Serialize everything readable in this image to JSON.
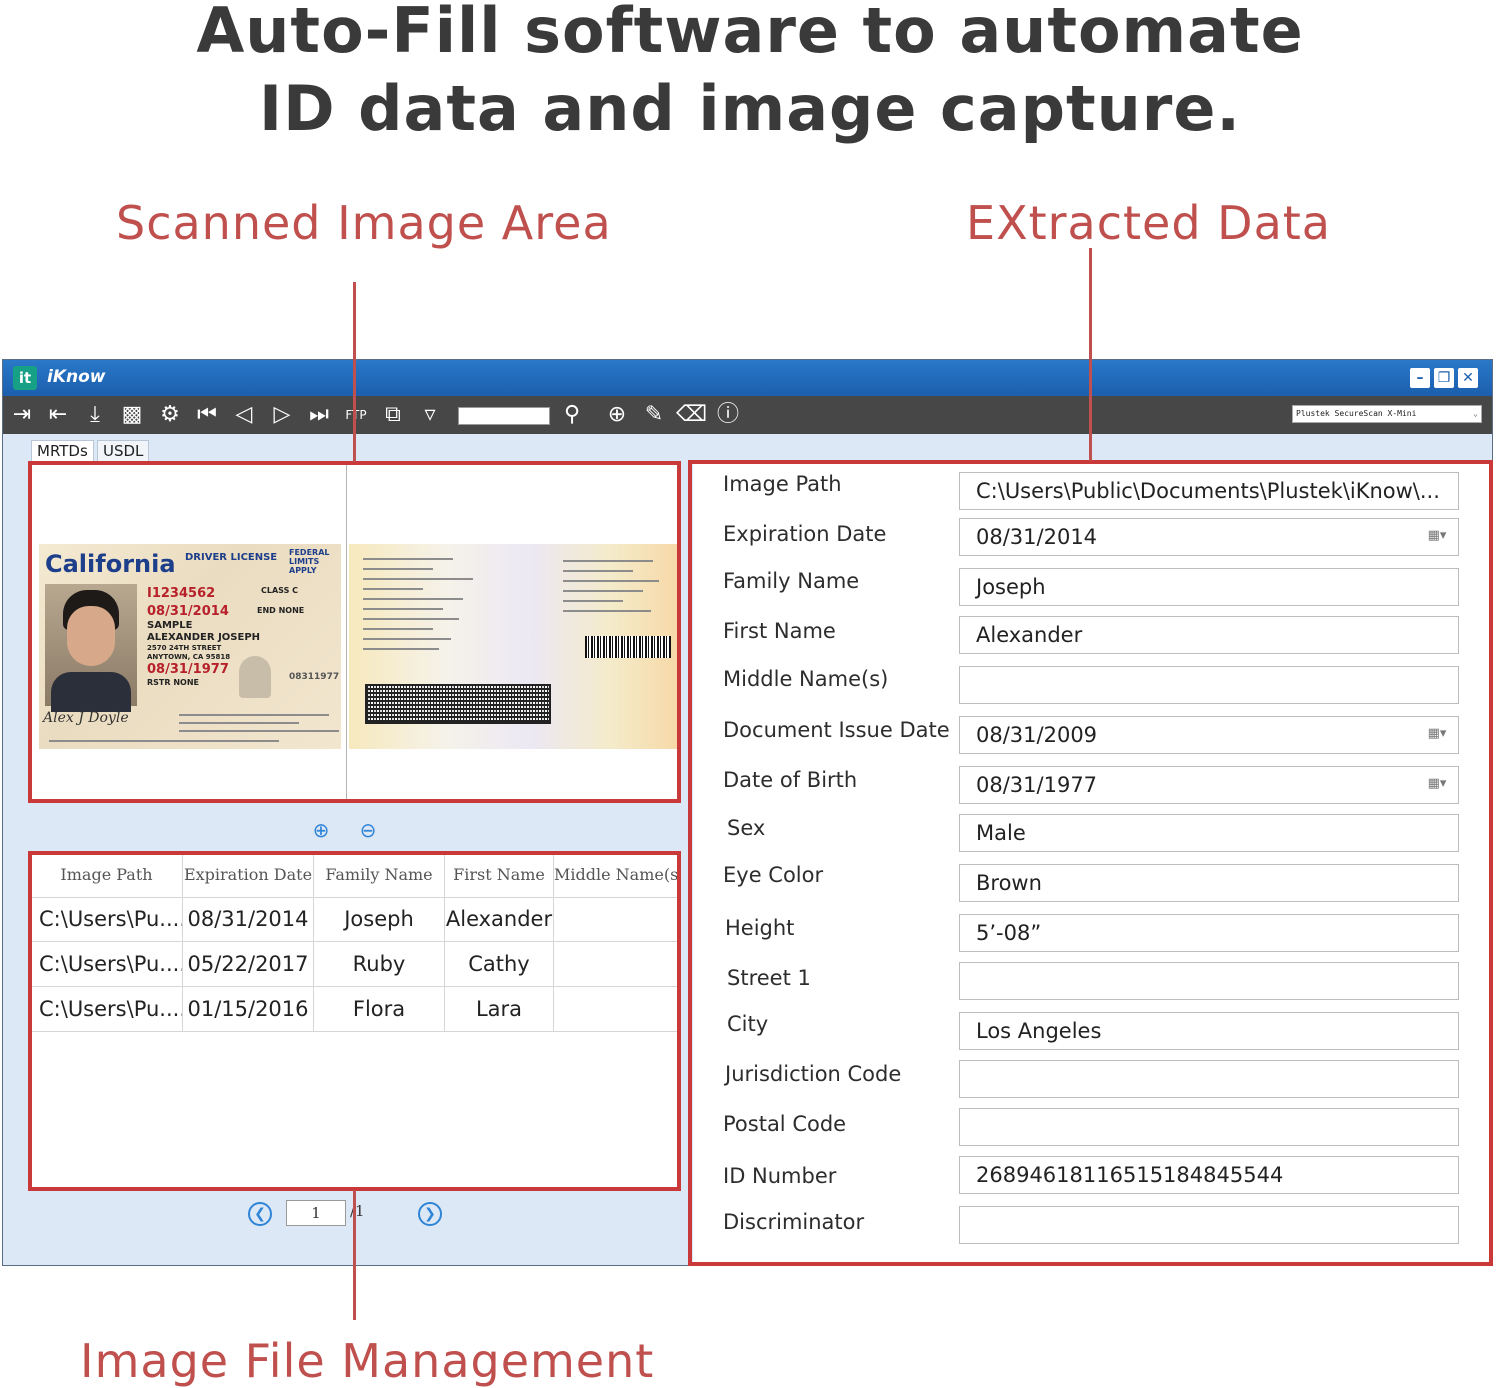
{
  "headline": {
    "line1": "Auto-Fill software to automate",
    "line2": "ID data and image capture."
  },
  "callouts": {
    "scanned_image_area": "Scanned Image Area",
    "extracted_data": "EXtracted Data",
    "image_file_management": "Image File Management"
  },
  "colors": {
    "accent_red": "#c9393a",
    "titlebar_blue": "#1b5fae",
    "toolbar_dark": "#474747",
    "panel_bg": "#dde8f6"
  },
  "app": {
    "logo_glyph": "it",
    "name": "iKnow",
    "window_controls": [
      "minimize",
      "restore",
      "close"
    ]
  },
  "toolbar": {
    "icons": [
      "export-icon",
      "import-icon",
      "download-icon",
      "delete-icon",
      "settings-icon",
      "first-page-icon",
      "previous-icon",
      "next-icon",
      "last-page-icon",
      "ftp-icon",
      "copy-icon",
      "filter-icon",
      "search-icon",
      "crosshair-icon",
      "edit-icon",
      "eraser-icon",
      "info-icon"
    ],
    "search_value": "",
    "scanner_select": "Plustek SecureScan X-Mini"
  },
  "tabs": [
    "MRTDs",
    "USDL"
  ],
  "id_card": {
    "state": "California",
    "type": "DRIVER LICENSE",
    "federal": "FEDERAL LIMITS APPLY",
    "dl_number": "I1234562",
    "exp": "08/31/2014",
    "last_name": "SAMPLE",
    "first_name": "ALEXANDER JOSEPH",
    "address1": "2570 24TH STREET",
    "address2": "ANYTOWN, CA 95818",
    "dob": "08/31/1977",
    "class": "CLASS C",
    "end": "END NONE",
    "rstr": "RSTR NONE",
    "side_dob": "08311977",
    "signature": "Alex J Doyle"
  },
  "zoom": {
    "zoom_in": "zoom-in-icon",
    "zoom_out": "zoom-out-icon"
  },
  "file_table": {
    "columns": [
      "Image Path",
      "Expiration Date",
      "Family Name",
      "First Name",
      "Middle Name(s)"
    ],
    "rows": [
      [
        "C:\\Users\\Pu....",
        "08/31/2014",
        "Joseph",
        "Alexander",
        ""
      ],
      [
        "C:\\Users\\Pu....",
        "05/22/2017",
        "Ruby",
        "Cathy",
        ""
      ],
      [
        "C:\\Users\\Pu....",
        "01/15/2016",
        "Flora",
        "Lara",
        ""
      ]
    ]
  },
  "pager": {
    "current": "1",
    "total": "/1"
  },
  "fields": [
    {
      "label": "Image Path",
      "value": "C:\\Users\\Public\\Documents\\Plustek\\iKnow\\...",
      "calendar": false
    },
    {
      "label": "Expiration Date",
      "value": "08/31/2014",
      "calendar": true
    },
    {
      "label": "Family Name",
      "value": "Joseph",
      "calendar": false
    },
    {
      "label": "First Name",
      "value": "Alexander",
      "calendar": false
    },
    {
      "label": "Middle Name(s)",
      "value": "",
      "calendar": false
    },
    {
      "label": "Document Issue Date",
      "value": "08/31/2009",
      "calendar": true
    },
    {
      "label": "Date of Birth",
      "value": "08/31/1977",
      "calendar": true
    },
    {
      "label": "Sex",
      "value": "Male",
      "calendar": false
    },
    {
      "label": "Eye Color",
      "value": "Brown",
      "calendar": false
    },
    {
      "label": "Height",
      "value": "5’-08”",
      "calendar": false
    },
    {
      "label": "Street 1",
      "value": "",
      "calendar": false
    },
    {
      "label": "City",
      "value": "Los Angeles",
      "calendar": false
    },
    {
      "label": "Jurisdiction Code",
      "value": "",
      "calendar": false
    },
    {
      "label": "Postal Code",
      "value": "",
      "calendar": false
    },
    {
      "label": "ID Number",
      "value": "26894618116515184845544",
      "calendar": false
    },
    {
      "label": "Discriminator",
      "value": "",
      "calendar": false
    }
  ]
}
